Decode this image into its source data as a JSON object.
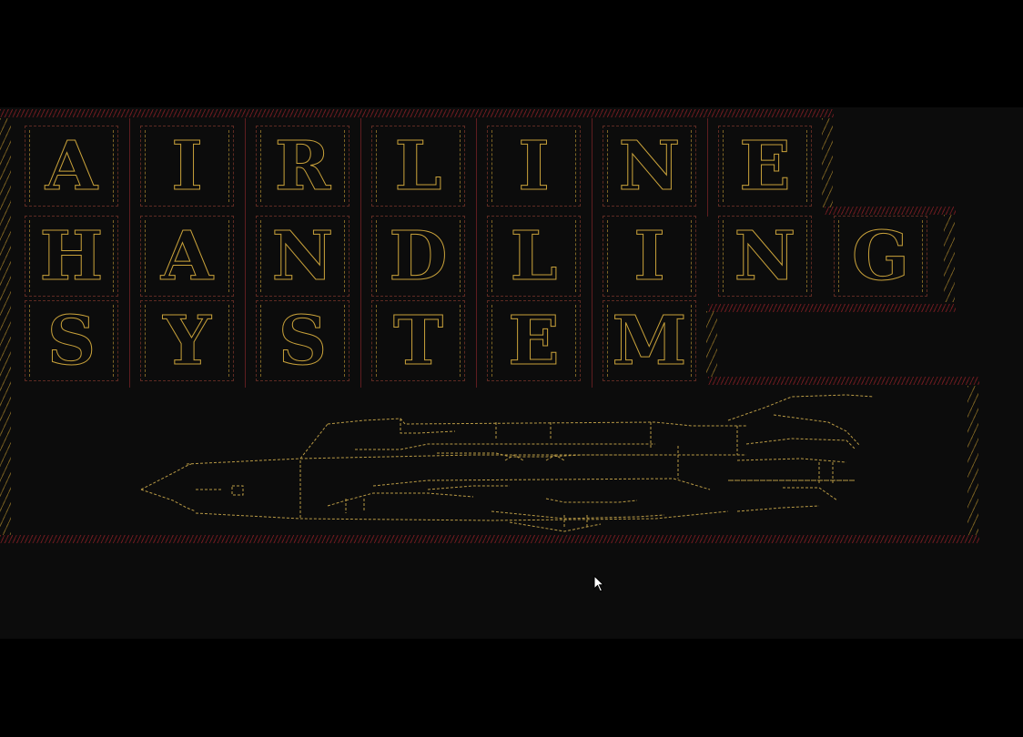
{
  "title": {
    "rows": [
      {
        "letters": [
          "A",
          "I",
          "R",
          "L",
          "I",
          "N",
          "E"
        ]
      },
      {
        "letters": [
          "H",
          "A",
          "N",
          "D",
          "L",
          "I",
          "N",
          "G"
        ]
      },
      {
        "letters": [
          "S",
          "Y",
          "S",
          "T",
          "E",
          "M"
        ]
      }
    ]
  },
  "colors": {
    "background": "#0c0c0c",
    "letters": "#c8a13a",
    "border_red": "#7a1c22",
    "art_gold": "#b99a45"
  },
  "icons": {
    "banner_art": "airliner-ascii-art-icon",
    "pointer": "mouse-pointer-icon"
  }
}
